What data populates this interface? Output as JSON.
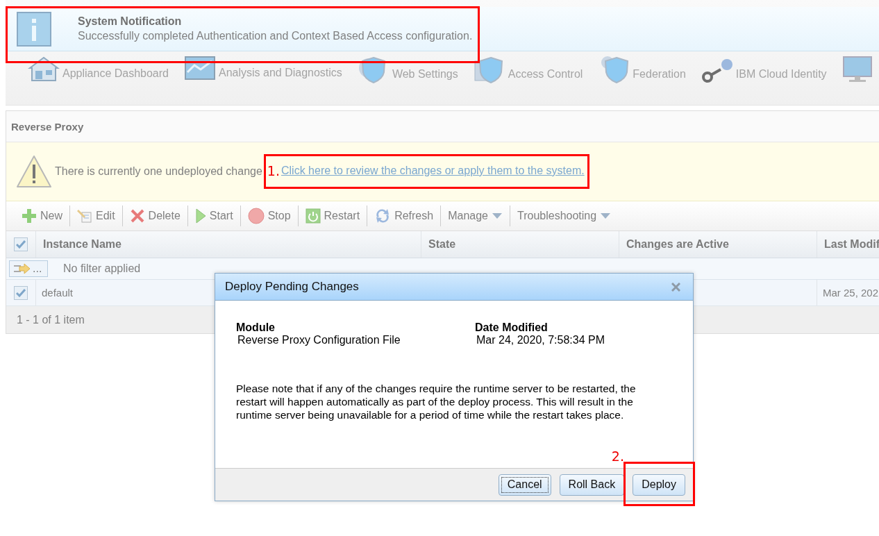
{
  "notification": {
    "title": "System Notification",
    "message": "Successfully completed Authentication and Context Based Access configuration."
  },
  "nav": [
    {
      "label": "Appliance Dashboard"
    },
    {
      "label": "Analysis and Diagnostics"
    },
    {
      "label": "Web Settings"
    },
    {
      "label": "Access Control"
    },
    {
      "label": "Federation"
    },
    {
      "label": "IBM Cloud Identity"
    }
  ],
  "panel": {
    "title": "Reverse Proxy"
  },
  "warning": {
    "message": "There is currently one undeployed change",
    "link": "Click here to review the changes or apply them to the system."
  },
  "annotations": [
    {
      "label": "1."
    },
    {
      "label": "2."
    }
  ],
  "toolbar": [
    {
      "label": "New",
      "kind": "button"
    },
    {
      "label": "Edit",
      "kind": "button"
    },
    {
      "label": "Delete",
      "kind": "button"
    },
    {
      "label": "Start",
      "kind": "button"
    },
    {
      "label": "Stop",
      "kind": "button"
    },
    {
      "label": "Restart",
      "kind": "button"
    },
    {
      "label": "Refresh",
      "kind": "button"
    },
    {
      "label": "Manage",
      "kind": "menu"
    },
    {
      "label": "Troubleshooting",
      "kind": "menu"
    }
  ],
  "table": {
    "select_all_checked": true,
    "columns": [
      "Instance Name",
      "State",
      "Changes are Active",
      "Last Modif"
    ],
    "filter": {
      "button": "...",
      "text": "No filter applied"
    },
    "rows": [
      {
        "checked": true,
        "instance_name": "default",
        "last_modified": "Mar 25, 202"
      }
    ],
    "footer": "1 - 1 of 1 item"
  },
  "dialog": {
    "title": "Deploy Pending Changes",
    "columns": [
      "Module",
      "Date Modified"
    ],
    "rows": [
      {
        "module": "Reverse Proxy Configuration File",
        "date_modified": "Mar 24, 2020, 7:58:34 PM"
      }
    ],
    "note": "Please note that if any of the changes require the runtime server to be restarted, the restart will happen automatically as part of the deploy process. This will result in the runtime server being unavailable for a period of time while the restart takes place.",
    "buttons": [
      {
        "label": "Cancel",
        "focused": true
      },
      {
        "label": "Roll Back",
        "focused": false
      },
      {
        "label": "Deploy",
        "focused": false
      }
    ]
  }
}
